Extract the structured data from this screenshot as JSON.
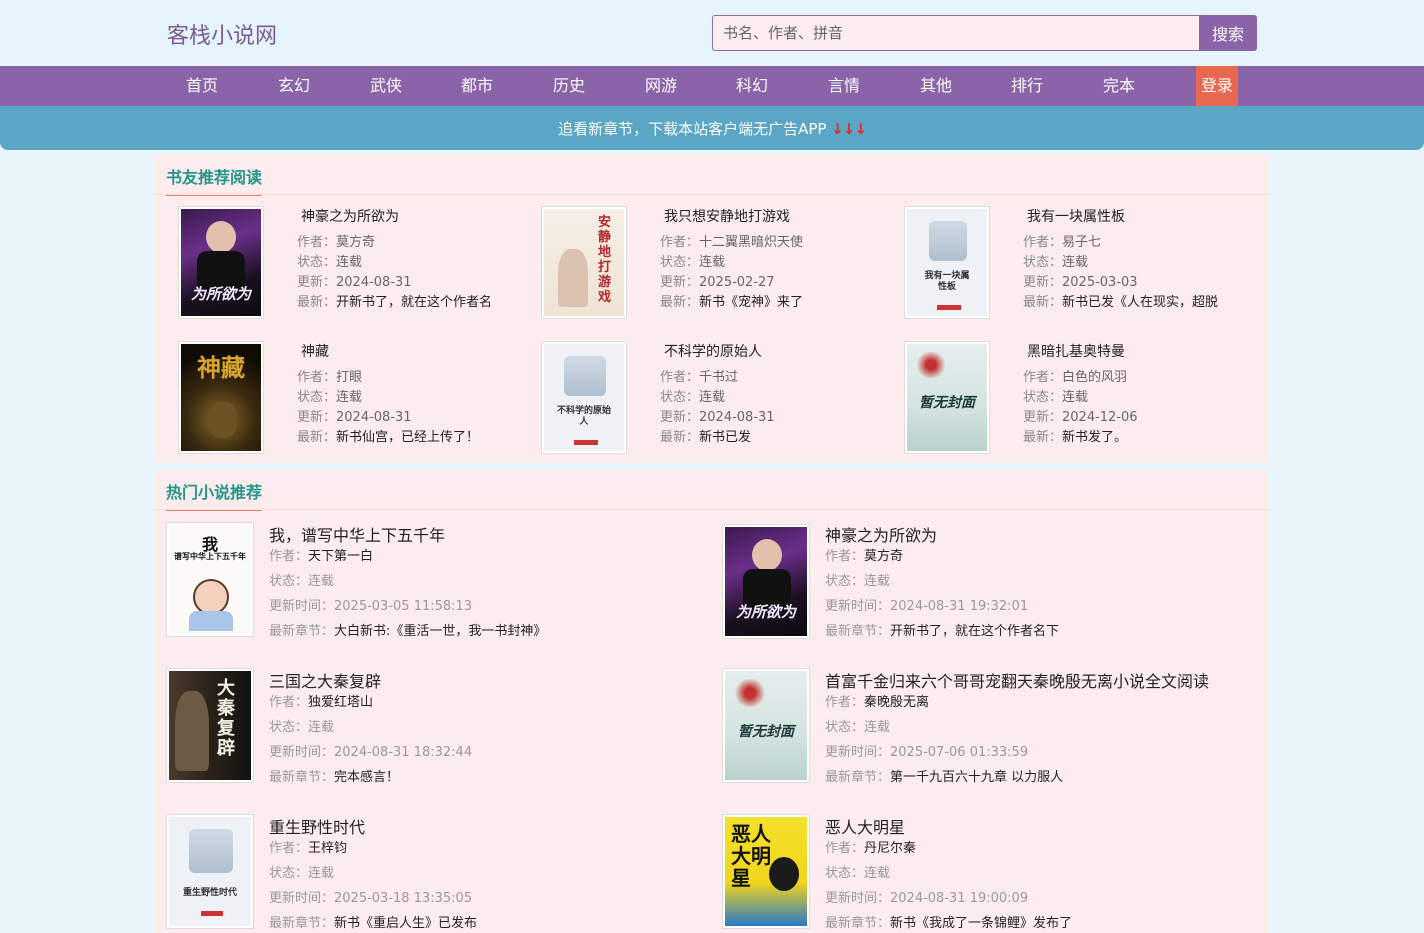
{
  "header": {
    "logo": "客栈小说网",
    "search_placeholder": "书名、作者、拼音",
    "search_button": "搜索"
  },
  "nav": {
    "items": [
      "首页",
      "玄幻",
      "武侠",
      "都市",
      "历史",
      "网游",
      "科幻",
      "言情",
      "其他",
      "排行",
      "完本"
    ],
    "login": "登录"
  },
  "banner": {
    "text": "追看新章节，下载本站客户端无广告APP",
    "arrows": "↓↓↓"
  },
  "recommend": {
    "title": "书友推荐阅读",
    "labels": {
      "author": "作者：",
      "status": "状态：",
      "update": "更新：",
      "latest": "最新："
    },
    "books": [
      {
        "title": "神豪之为所欲为",
        "author": "莫方奇",
        "status": "连载",
        "update": "2024-08-31",
        "latest": "开新书了，就在这个作者名",
        "cover_text": "为所欲为"
      },
      {
        "title": "我只想安静地打游戏",
        "author": "十二翼黑暗炽天使",
        "status": "连载",
        "update": "2025-02-27",
        "latest": "新书《宠神》来了",
        "cover_text": "安静地打游戏"
      },
      {
        "title": "我有一块属性板",
        "author": "易子七",
        "status": "连载",
        "update": "2025-03-03",
        "latest": "新书已发《人在现实，超脱",
        "cover_text": "我有一块属性板"
      },
      {
        "title": "神藏",
        "author": "打眼",
        "status": "连载",
        "update": "2024-08-31",
        "latest": "新书仙宫，已经上传了！",
        "cover_text": "神藏"
      },
      {
        "title": "不科学的原始人",
        "author": "千书过",
        "status": "连载",
        "update": "2024-08-31",
        "latest": "新书已发",
        "cover_text": "不科学的原始人"
      },
      {
        "title": "黑暗扎基奥特曼",
        "author": "白色的风羽",
        "status": "连载",
        "update": "2024-12-06",
        "latest": "新书发了。",
        "cover_text": "暂无封面"
      }
    ]
  },
  "hot": {
    "title": "热门小说推荐",
    "labels": {
      "author": "作者：",
      "status": "状态：",
      "update": "更新时间：",
      "latest": "最新章节："
    },
    "books": [
      {
        "title": "我，谱写中华上下五千年",
        "author": "天下第一白",
        "status": "连载",
        "update": "2025-03-05 11:58:13",
        "latest": "大白新书:《重活一世，我一书封神》",
        "cover_text": "谱写中华上下五千年"
      },
      {
        "title": "神豪之为所欲为",
        "author": "莫方奇",
        "status": "连载",
        "update": "2024-08-31 19:32:01",
        "latest": "开新书了，就在这个作者名下",
        "cover_text": "为所欲为"
      },
      {
        "title": "三国之大秦复辟",
        "author": "独爱红塔山",
        "status": "连载",
        "update": "2024-08-31 18:32:44",
        "latest": "完本感言！",
        "cover_text": "大秦复辟"
      },
      {
        "title": "首富千金归来六个哥哥宠翻天秦晚殷无离小说全文阅读",
        "author": "秦晚殷无离",
        "status": "连载",
        "update": "2025-07-06 01:33:59",
        "latest": "第一千九百六十九章 以力服人",
        "cover_text": "暂无封面"
      },
      {
        "title": "重生野性时代",
        "author": "王梓钧",
        "status": "连载",
        "update": "2025-03-18 13:35:05",
        "latest": "新书《重启人生》已发布",
        "cover_text": "重生野性时代"
      },
      {
        "title": "恶人大明星",
        "author": "丹尼尔秦",
        "status": "连载",
        "update": "2024-08-31 19:00:09",
        "latest": "新书《我成了一条锦鲤》发布了",
        "cover_text": "恶人大明星"
      }
    ]
  }
}
